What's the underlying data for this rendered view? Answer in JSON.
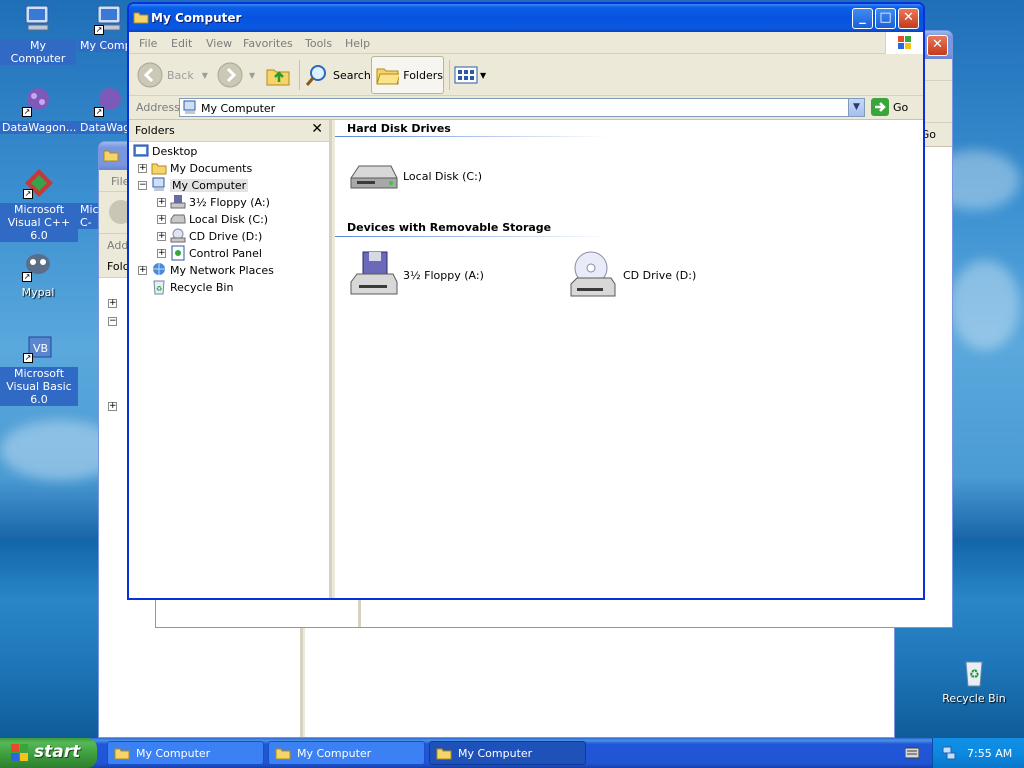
{
  "desktop": {
    "icons": [
      {
        "label": "My Computer"
      },
      {
        "label": "My Computer"
      },
      {
        "label": "DataWagon..."
      },
      {
        "label": "DataWag"
      },
      {
        "label": "Microsoft Visual C++ 6.0"
      },
      {
        "label": "Micr C-"
      },
      {
        "label": "Mypal"
      },
      {
        "label": "Microsoft Visual Basic 6.0"
      },
      {
        "label": "Recycle Bin"
      }
    ]
  },
  "back_window": {
    "menu_first": "File",
    "address_label": "Add",
    "folders_label": "Fold",
    "go_fragment": "Go"
  },
  "window": {
    "title": "My Computer",
    "menu": [
      "File",
      "Edit",
      "View",
      "Favorites",
      "Tools",
      "Help"
    ],
    "toolbar": {
      "back": "Back",
      "search": "Search",
      "folders": "Folders"
    },
    "address": {
      "label": "Address",
      "value": "My Computer",
      "go": "Go"
    },
    "folders_pane": {
      "title": "Folders",
      "tree": [
        {
          "label": "Desktop"
        },
        {
          "label": "My Documents"
        },
        {
          "label": "My Computer"
        },
        {
          "label": "3½ Floppy (A:)"
        },
        {
          "label": "Local Disk (C:)"
        },
        {
          "label": "CD Drive (D:)"
        },
        {
          "label": "Control Panel"
        },
        {
          "label": "My Network Places"
        },
        {
          "label": "Recycle Bin"
        }
      ]
    },
    "groups": [
      {
        "heading": "Hard Disk Drives",
        "items": [
          {
            "label": "Local Disk (C:)",
            "icon": "hard-disk-icon"
          }
        ]
      },
      {
        "heading": "Devices with Removable Storage",
        "items": [
          {
            "label": "3½ Floppy (A:)",
            "icon": "floppy-drive-icon"
          },
          {
            "label": "CD Drive (D:)",
            "icon": "cd-drive-icon"
          }
        ]
      }
    ]
  },
  "taskbar": {
    "start": "start",
    "tasks": [
      {
        "label": "My Computer"
      },
      {
        "label": "My Computer"
      },
      {
        "label": "My Computer"
      }
    ],
    "clock": "7:55 AM"
  }
}
